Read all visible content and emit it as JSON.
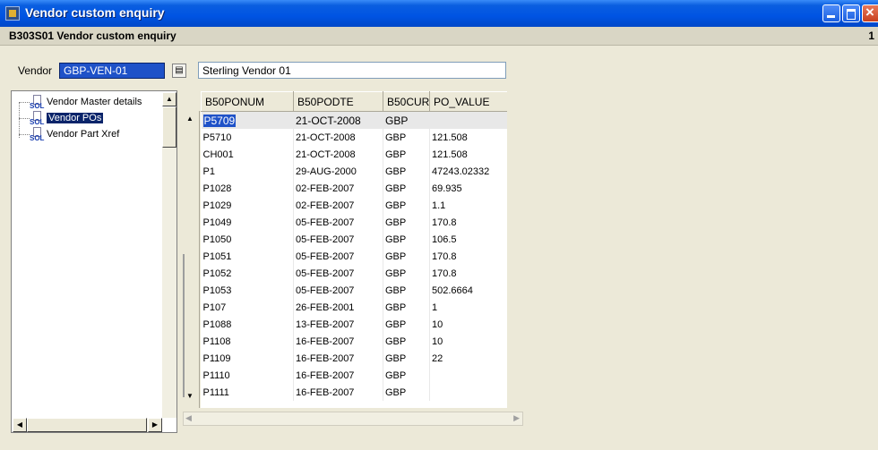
{
  "window": {
    "title": "Vendor custom enquiry"
  },
  "header": {
    "subtitle": "B303S01 Vendor custom enquiry",
    "page_number": "1"
  },
  "vendor": {
    "label": "Vendor",
    "code": "GBP-VEN-01",
    "name": "Sterling Vendor 01"
  },
  "tree": {
    "items": [
      {
        "label": "Vendor Master details",
        "selected": false
      },
      {
        "label": "Vendor POs",
        "selected": true
      },
      {
        "label": "Vendor Part Xref",
        "selected": false
      }
    ]
  },
  "grid": {
    "columns": [
      "B50PONUM",
      "B50PODTE",
      "B50CUR",
      "PO_VALUE"
    ],
    "rows": [
      [
        "P5709",
        "21-OCT-2008",
        "GBP",
        ""
      ],
      [
        "P5710",
        "21-OCT-2008",
        "GBP",
        "121.508"
      ],
      [
        "CH001",
        "21-OCT-2008",
        "GBP",
        "121.508"
      ],
      [
        "P1",
        "29-AUG-2000",
        "GBP",
        "47243.02332"
      ],
      [
        "P1028",
        "02-FEB-2007",
        "GBP",
        "69.935"
      ],
      [
        "P1029",
        "02-FEB-2007",
        "GBP",
        "1.1"
      ],
      [
        "P1049",
        "05-FEB-2007",
        "GBP",
        "170.8"
      ],
      [
        "P1050",
        "05-FEB-2007",
        "GBP",
        "106.5"
      ],
      [
        "P1051",
        "05-FEB-2007",
        "GBP",
        "170.8"
      ],
      [
        "P1052",
        "05-FEB-2007",
        "GBP",
        "170.8"
      ],
      [
        "P1053",
        "05-FEB-2007",
        "GBP",
        "502.6664"
      ],
      [
        "P107",
        "26-FEB-2001",
        "GBP",
        "1"
      ],
      [
        "P1088",
        "13-FEB-2007",
        "GBP",
        "10"
      ],
      [
        "P1108",
        "16-FEB-2007",
        "GBP",
        "10"
      ],
      [
        "P1109",
        "16-FEB-2007",
        "GBP",
        "22"
      ],
      [
        "P1110",
        "16-FEB-2007",
        "GBP",
        ""
      ],
      [
        "P1111",
        "16-FEB-2007",
        "GBP",
        ""
      ]
    ]
  }
}
